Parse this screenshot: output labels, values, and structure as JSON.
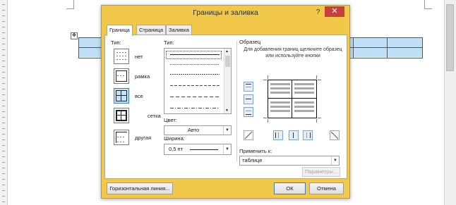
{
  "dialog": {
    "title": "Границы и заливка",
    "help_label": "?",
    "close_label": "✕",
    "tabs": [
      {
        "label": "Граница",
        "active": true
      },
      {
        "label": "Страница",
        "active": false
      },
      {
        "label": "Заливка",
        "active": false
      }
    ],
    "setting": {
      "label": "Тип:",
      "presets": [
        {
          "label": "нет",
          "icon": "border-none-icon",
          "selected": false
        },
        {
          "label": "рамка",
          "icon": "border-box-icon",
          "selected": false
        },
        {
          "label": "все",
          "icon": "border-all-icon",
          "selected": true
        },
        {
          "label": "сетка",
          "icon": "border-grid-icon",
          "selected": false
        },
        {
          "label": "другая",
          "icon": "border-custom-icon",
          "selected": false
        }
      ]
    },
    "style": {
      "label": "Тип:",
      "color_label": "Цвет:",
      "color_value": "Авто",
      "width_label": "Ширина:",
      "width_value": "0,5 пт"
    },
    "preview": {
      "label": "Образец",
      "hint": "Для добавления границ щелкните образец или используйте кнопки"
    },
    "apply": {
      "label": "Применить к:",
      "value": "таблице",
      "options_button": "Параметры..."
    },
    "footer": {
      "horizontal_line": "Горизонтальная линия...",
      "ok": "ОК",
      "cancel": "Отмена"
    }
  },
  "colors": {
    "dialog_frame": "#f2c84b",
    "close_button": "#c7413a",
    "selection": "#c7e2f7",
    "table_fill": "#bfe0f7"
  }
}
